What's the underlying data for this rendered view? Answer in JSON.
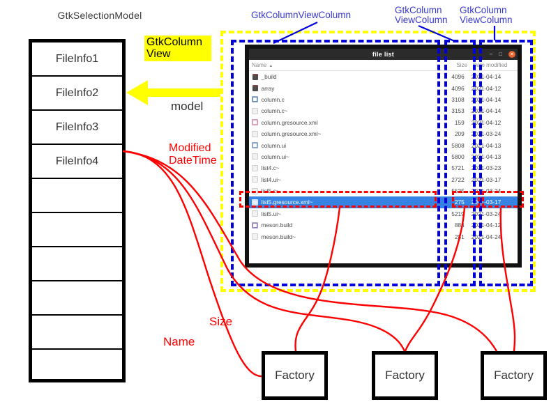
{
  "model": {
    "title": "GtkSelectionModel",
    "rows": [
      {
        "label": "FileInfo1"
      },
      {
        "label": "FileInfo2"
      },
      {
        "label": "FileInfo3"
      },
      {
        "label": "FileInfo4"
      },
      {
        "label": ""
      },
      {
        "label": ""
      },
      {
        "label": ""
      },
      {
        "label": ""
      },
      {
        "label": ""
      },
      {
        "label": ""
      }
    ]
  },
  "annotations": {
    "gtk_column_view_label": "GtkColumn\nView",
    "gtk_column_view_label_line1": "GtkColumn",
    "gtk_column_view_label_line2": "View",
    "model_edge_label": "model",
    "column_label_name": "GtkColumnViewColumn",
    "column_label_size_line1": "GtkColumn",
    "column_label_size_line2": "ViewColumn",
    "column_label_date_line1": "GtkColumn",
    "column_label_date_line2": "ViewColumn",
    "modified_datetime_line1": "Modified",
    "modified_datetime_line2": "DateTime",
    "size_label": "Size",
    "name_label": "Name",
    "colors": {
      "highlight_yellow": "#ffff00",
      "column_blue": "#0000dd",
      "cell_red": "#ff0000",
      "selection_blue": "#3584e4"
    }
  },
  "window": {
    "title": "file list",
    "controls": {
      "minimize": "–",
      "maximize": "□",
      "close": "✕"
    },
    "columns": [
      {
        "key": "name",
        "header": "Name",
        "sort_indicator": "▲"
      },
      {
        "key": "size",
        "header": "Size",
        "sort_indicator": ""
      },
      {
        "key": "date",
        "header": "Date modified",
        "sort_indicator": ""
      }
    ],
    "rows": [
      {
        "icon": "folder-icon",
        "icon_class": "folder",
        "name": "_build",
        "size": "4096",
        "date": "2021-04-14",
        "selected": false
      },
      {
        "icon": "folder-icon",
        "icon_class": "folder",
        "name": "array",
        "size": "4096",
        "date": "2021-04-12",
        "selected": false
      },
      {
        "icon": "c-source-file-icon",
        "icon_class": "c",
        "name": "column.c",
        "size": "3108",
        "date": "2021-04-14",
        "selected": false
      },
      {
        "icon": "backup-file-icon",
        "icon_class": "bak",
        "name": "column.c~",
        "size": "3153",
        "date": "2021-04-14",
        "selected": false
      },
      {
        "icon": "xml-file-icon",
        "icon_class": "xml",
        "name": "column.gresource.xml",
        "size": "159",
        "date": "2021-04-12",
        "selected": false
      },
      {
        "icon": "backup-file-icon",
        "icon_class": "bak",
        "name": "column.gresource.xml~",
        "size": "209",
        "date": "2021-03-24",
        "selected": false
      },
      {
        "icon": "ui-file-icon",
        "icon_class": "ui",
        "name": "column.ui",
        "size": "5808",
        "date": "2021-04-13",
        "selected": false
      },
      {
        "icon": "backup-file-icon",
        "icon_class": "bak",
        "name": "column.ui~",
        "size": "5800",
        "date": "2021-04-13",
        "selected": false
      },
      {
        "icon": "backup-file-icon",
        "icon_class": "bak",
        "name": "list4.c~",
        "size": "5721",
        "date": "2021-03-23",
        "selected": false
      },
      {
        "icon": "backup-file-icon",
        "icon_class": "bak",
        "name": "list4.ui~",
        "size": "2722",
        "date": "2021-03-17",
        "selected": false
      },
      {
        "icon": "backup-file-icon",
        "icon_class": "bak",
        "name": "list5.c~",
        "size": "5525",
        "date": "2021-03-24",
        "selected": false
      },
      {
        "icon": "backup-file-icon",
        "icon_class": "bak",
        "name": "list5.gresource.xml~",
        "size": "275",
        "date": "2021-03-17",
        "selected": true
      },
      {
        "icon": "backup-file-icon",
        "icon_class": "bak",
        "name": "list5.ui~",
        "size": "5219",
        "date": "2021-03-24",
        "selected": false
      },
      {
        "icon": "meson-file-icon",
        "icon_class": "build",
        "name": "meson.build",
        "size": "884",
        "date": "2021-04-12",
        "selected": false
      },
      {
        "icon": "backup-file-icon",
        "icon_class": "bak",
        "name": "meson.build~",
        "size": "281",
        "date": "2021-04-24",
        "selected": false
      }
    ]
  },
  "factories": [
    {
      "label": "Factory"
    },
    {
      "label": "Factory"
    },
    {
      "label": "Factory"
    }
  ]
}
